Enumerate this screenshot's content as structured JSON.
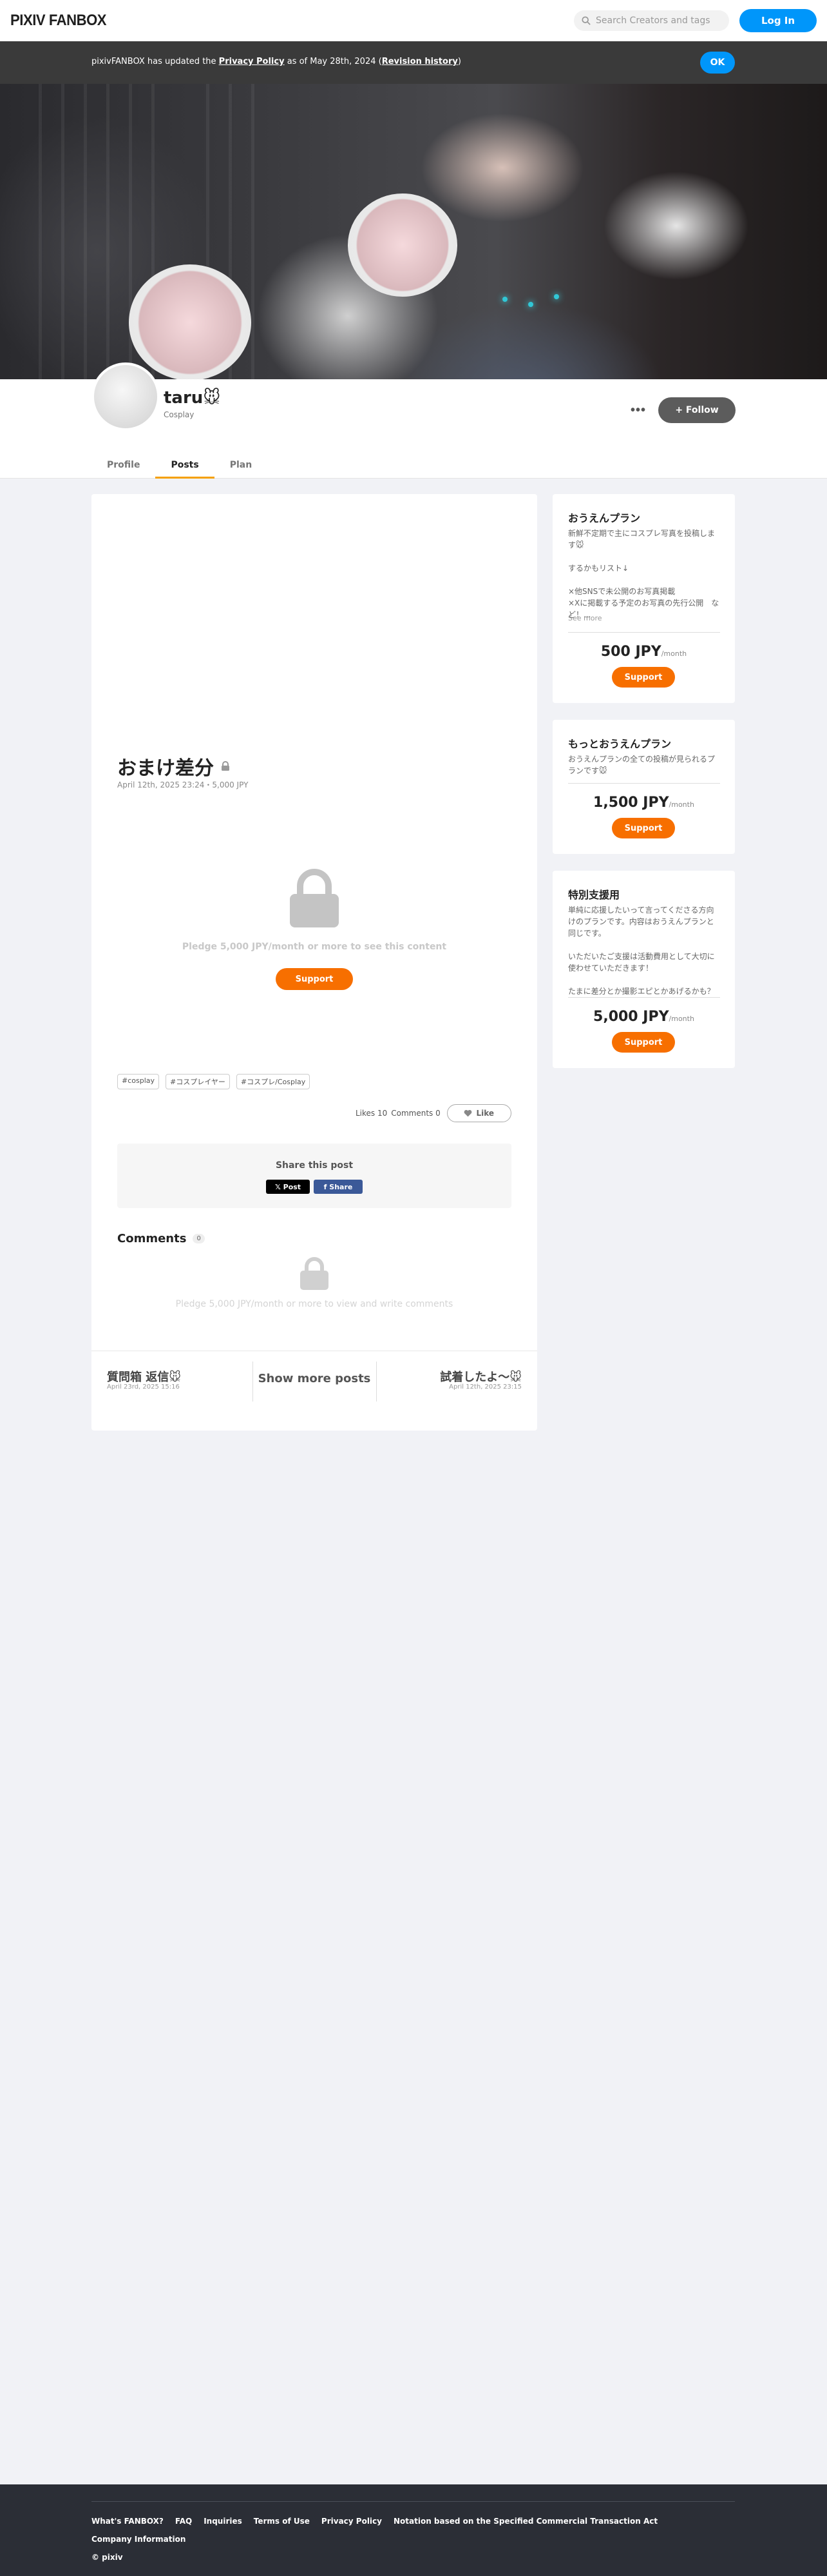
{
  "header": {
    "logo": "PIXIV FANBOX",
    "search_placeholder": "Search Creators and tags",
    "login_label": "Log In"
  },
  "notice": {
    "text_before": "pixivFANBOX has updated the ",
    "policy_link": "Privacy Policy",
    "text_middle": " as of May 28th, 2024 (",
    "history_link": "Revision history",
    "text_after": ")",
    "ok_label": "OK"
  },
  "creator": {
    "name": "taru🐭",
    "category": "Cosplay",
    "more_label": "•••",
    "follow_label": "+ Follow"
  },
  "tabs": [
    {
      "label": "Profile"
    },
    {
      "label": "Posts",
      "active": true
    },
    {
      "label": "Plan"
    }
  ],
  "post": {
    "title": "おまけ差分",
    "meta": "April 12th, 2025 23:24・5,000 JPY",
    "pledge_text": "Pledge 5,000 JPY/month or more to see this content",
    "support_label": "Support",
    "tags": [
      "#cosplay",
      "#コスプレイヤー",
      "#コスプレ/Cosplay"
    ],
    "likes_text": "Likes 10",
    "comments_text": "Comments 0",
    "like_label": "Like",
    "share_title": "Share this post",
    "share_x_label": "𝕏 Post",
    "share_fb_label": "f Share",
    "comments_heading": "Comments",
    "comments_count": "0",
    "comment_pledge": "Pledge 5,000 JPY/month or more to view and write comments"
  },
  "post_nav": {
    "prev_title": "質問箱 返信🐭",
    "prev_date": "April 23rd, 2025 15:16",
    "show_more": "Show more posts",
    "next_title": "試着したよ〜🐭",
    "next_date": "April 12th, 2025 23:15"
  },
  "plans": [
    {
      "name": "おうえんプラン",
      "desc": "新鮮不定期で主にコスプレ写真を投稿します🐭\n\nするかもリスト↓\n\n×他SNSで未公開のお写真掲載\n×Xに掲載する予定のお写真の先行公開　など！...",
      "see_more": "See more",
      "price": "500 JPY",
      "per": "/month",
      "support_label": "Support"
    },
    {
      "name": "もっとおうえんプラン",
      "desc": "おうえんプランの全ての投稿が見られるプランです🐭",
      "price": "1,500 JPY",
      "per": "/month",
      "support_label": "Support"
    },
    {
      "name": "特別支援用",
      "desc": "単純に応援したいって言ってくださる方向けのプランです。内容はおうえんプランと同じです。\n\nいただいたご支援は活動費用として大切に使わせていただきます！\n\nたまに差分とか撮影エピとかあげるかも？",
      "price": "5,000 JPY",
      "per": "/month",
      "support_label": "Support"
    }
  ],
  "footer": {
    "links": [
      "What's FANBOX?",
      "FAQ",
      "Inquiries",
      "Terms of Use",
      "Privacy Policy",
      "Notation based on the Specified Commercial Transaction Act"
    ],
    "company": "Company Information",
    "copyright": "© pixiv"
  },
  "colors": {
    "accent_blue": "#0096fa",
    "support_orange": "#f76f00",
    "tab_underline": "#f5a000",
    "footer_bg": "#2b2e36"
  }
}
